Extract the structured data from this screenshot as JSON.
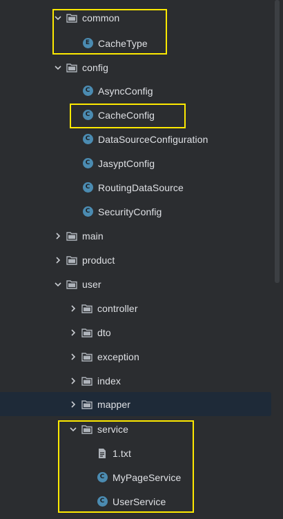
{
  "project_tree": {
    "items": [
      {
        "label": "common",
        "type": "folder",
        "expanded": true
      },
      {
        "label": "CacheType",
        "type": "enum",
        "icon_letter": "E"
      },
      {
        "label": "config",
        "type": "folder",
        "expanded": true
      },
      {
        "label": "AsyncConfig",
        "type": "class",
        "icon_letter": "C"
      },
      {
        "label": "CacheConfig",
        "type": "class",
        "icon_letter": "C"
      },
      {
        "label": "DataSourceConfiguration",
        "type": "class",
        "icon_letter": "C"
      },
      {
        "label": "JasyptConfig",
        "type": "class",
        "icon_letter": "C"
      },
      {
        "label": "RoutingDataSource",
        "type": "class",
        "icon_letter": "C"
      },
      {
        "label": "SecurityConfig",
        "type": "class",
        "icon_letter": "C"
      },
      {
        "label": "main",
        "type": "folder",
        "expanded": false
      },
      {
        "label": "product",
        "type": "folder",
        "expanded": false
      },
      {
        "label": "user",
        "type": "folder",
        "expanded": true
      },
      {
        "label": "controller",
        "type": "folder",
        "expanded": false
      },
      {
        "label": "dto",
        "type": "folder",
        "expanded": false
      },
      {
        "label": "exception",
        "type": "folder",
        "expanded": false
      },
      {
        "label": "index",
        "type": "folder",
        "expanded": false
      },
      {
        "label": "mapper",
        "type": "folder",
        "expanded": false,
        "selected": true
      },
      {
        "label": "service",
        "type": "folder",
        "expanded": true
      },
      {
        "label": "1.txt",
        "type": "text-file"
      },
      {
        "label": "MyPageService",
        "type": "class",
        "icon_letter": "C"
      },
      {
        "label": "UserService",
        "type": "class",
        "icon_letter": "C"
      }
    ]
  },
  "colors": {
    "background": "#2b2d30",
    "selected_row": "#1e2a38",
    "class_icon": "#4b8bb1",
    "highlight_box": "#ffea00",
    "text": "#dfe1e5"
  }
}
